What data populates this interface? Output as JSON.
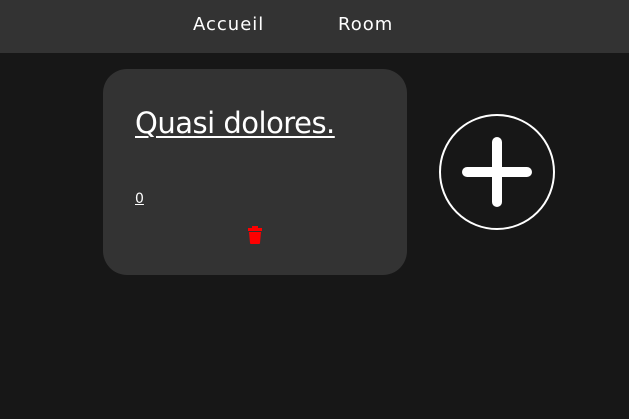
{
  "nav": {
    "home_label": "Accueil",
    "room_label": "Room"
  },
  "card": {
    "title": "Quasi dolores.",
    "count": "0",
    "delete_icon": "trash-icon",
    "delete_color": "#ff0000"
  },
  "add_button": {
    "icon": "plus-icon"
  },
  "colors": {
    "background": "#171717",
    "surface": "#333333",
    "text": "#ffffff",
    "danger": "#ff0000"
  }
}
